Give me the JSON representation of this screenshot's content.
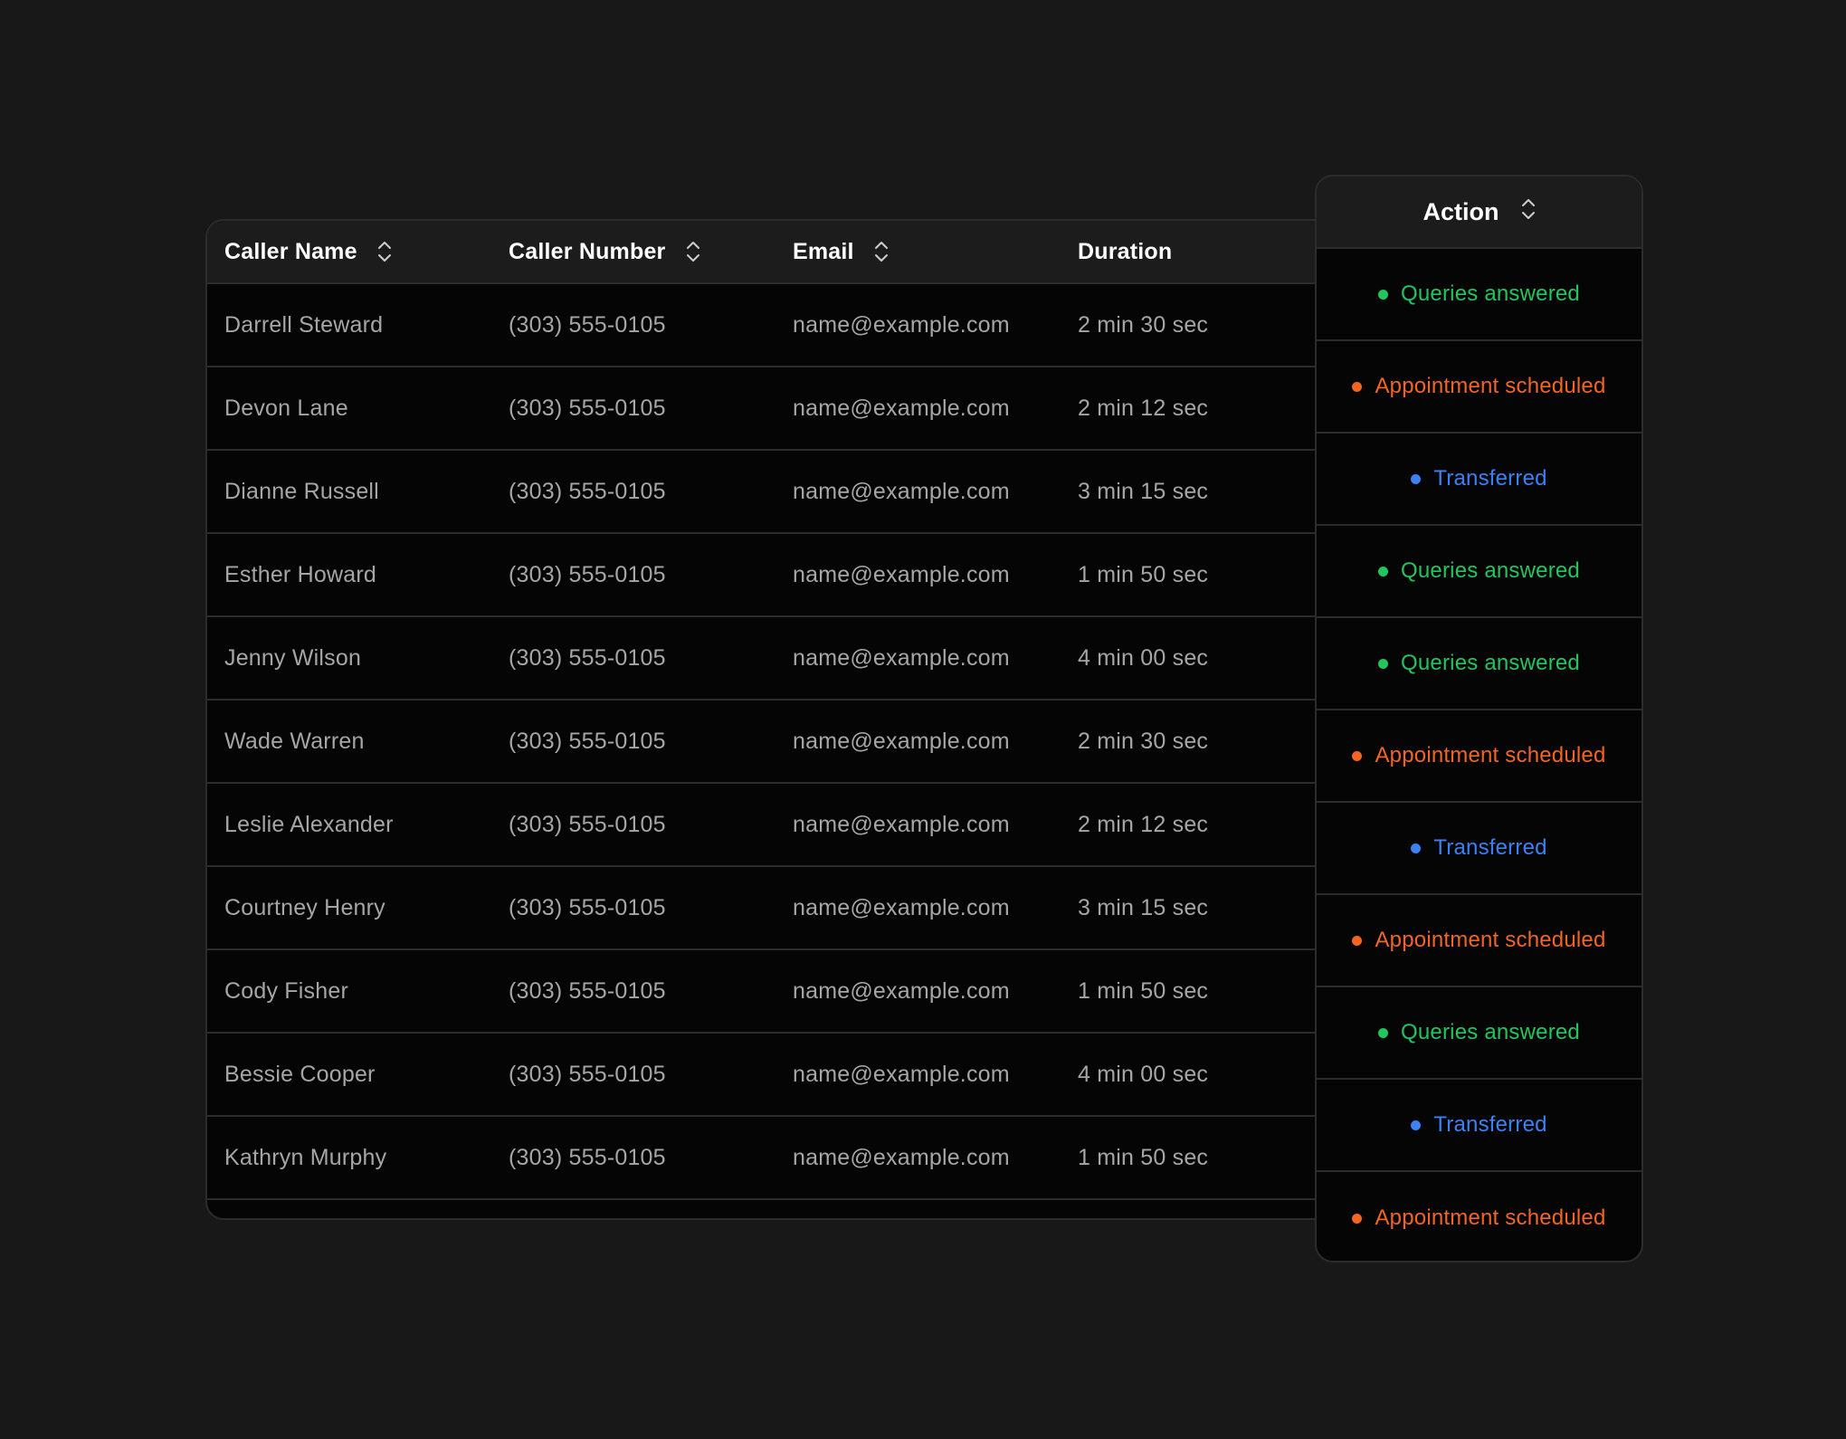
{
  "table": {
    "headers": {
      "caller_name": "Caller Name",
      "caller_number": "Caller Number",
      "email": "Email",
      "duration": "Duration",
      "action": "Action"
    },
    "rows": [
      {
        "name": "Darrell Steward",
        "number": "(303) 555-0105",
        "email": "name@example.com",
        "duration": "2 min 30 sec",
        "action": "Queries answered",
        "action_color": "#22c55e"
      },
      {
        "name": "Devon Lane",
        "number": "(303) 555-0105",
        "email": "name@example.com",
        "duration": "2 min 12 sec",
        "action": "Appointment scheduled",
        "action_color": "#f26522"
      },
      {
        "name": "Dianne Russell",
        "number": "(303) 555-0105",
        "email": "name@example.com",
        "duration": "3 min 15 sec",
        "action": "Transferred",
        "action_color": "#3b82f6"
      },
      {
        "name": "Esther Howard",
        "number": "(303) 555-0105",
        "email": "name@example.com",
        "duration": "1 min 50 sec",
        "action": "Queries answered",
        "action_color": "#22c55e"
      },
      {
        "name": "Jenny Wilson",
        "number": "(303) 555-0105",
        "email": "name@example.com",
        "duration": "4 min 00 sec",
        "action": "Queries answered",
        "action_color": "#22c55e"
      },
      {
        "name": "Wade Warren",
        "number": "(303) 555-0105",
        "email": "name@example.com",
        "duration": "2 min 30 sec",
        "action": "Appointment scheduled",
        "action_color": "#f26522"
      },
      {
        "name": "Leslie Alexander",
        "number": "(303) 555-0105",
        "email": "name@example.com",
        "duration": "2 min 12 sec",
        "action": "Transferred",
        "action_color": "#3b82f6"
      },
      {
        "name": "Courtney Henry",
        "number": "(303) 555-0105",
        "email": "name@example.com",
        "duration": "3 min 15 sec",
        "action": "Appointment scheduled",
        "action_color": "#f26522"
      },
      {
        "name": "Cody Fisher",
        "number": "(303) 555-0105",
        "email": "name@example.com",
        "duration": "1 min 50 sec",
        "action": "Queries answered",
        "action_color": "#22c55e"
      },
      {
        "name": "Bessie Cooper",
        "number": "(303) 555-0105",
        "email": "name@example.com",
        "duration": "4 min 00 sec",
        "action": "Transferred",
        "action_color": "#3b82f6"
      },
      {
        "name": "Kathryn Murphy",
        "number": "(303) 555-0105",
        "email": "name@example.com",
        "duration": "1 min 50 sec",
        "action": "Appointment scheduled",
        "action_color": "#f26522"
      }
    ]
  },
  "icons": {
    "sort": "sort-icon"
  },
  "colors": {
    "background": "#181818",
    "queries_answered": "#22c55e",
    "appointment_scheduled": "#f26522",
    "transferred": "#3b82f6"
  }
}
